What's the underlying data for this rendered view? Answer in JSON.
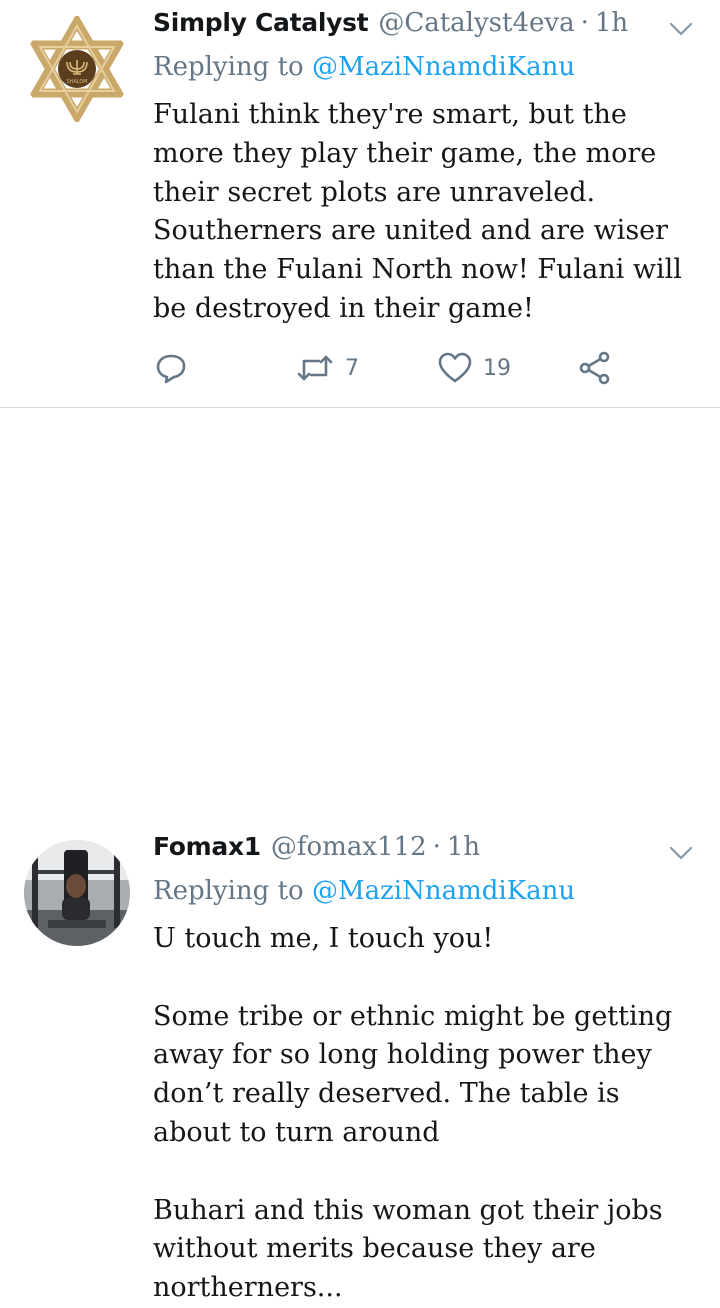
{
  "tweets": [
    {
      "name": "Simply Catalyst",
      "handle": "@Catalyst4eva",
      "separator": "·",
      "time": "1h",
      "replying_prefix": "Replying to",
      "replying_to": "@MaziNnamdiKanu",
      "text": "Fulani think they're smart, but the more they play their game, the more their secret plots are unraveled. Southerners are united and are wiser than the Fulani North now! Fulani will be destroyed in their game!",
      "retweets": "7",
      "likes": "19",
      "avatar_icon": "star-of-david-logo",
      "avatar_text": "SHALOM"
    },
    {
      "name": "Fomax1",
      "handle": "@fomax112",
      "separator": "·",
      "time": "1h",
      "replying_prefix": "Replying to",
      "replying_to": "@MaziNnamdiKanu",
      "text": "U touch me, I touch you!\n\nSome tribe or ethnic might be getting away for so long holding power they don’t really deserved.  The table is about to turn around\n\nBuhari and  this woman got their jobs without merits because they are northerners...",
      "avatar_icon": "gym-photo-avatar"
    }
  ],
  "icons": {
    "reply": "reply-icon",
    "retweet": "retweet-icon",
    "like": "heart-icon",
    "share": "share-icon",
    "caret": "chevron-down-icon"
  },
  "colors": {
    "link": "#1da1f2",
    "secondary_text": "#657786",
    "primary_text": "#14171a",
    "divider": "#d8dde2",
    "star_gold": "#c9a86a"
  }
}
